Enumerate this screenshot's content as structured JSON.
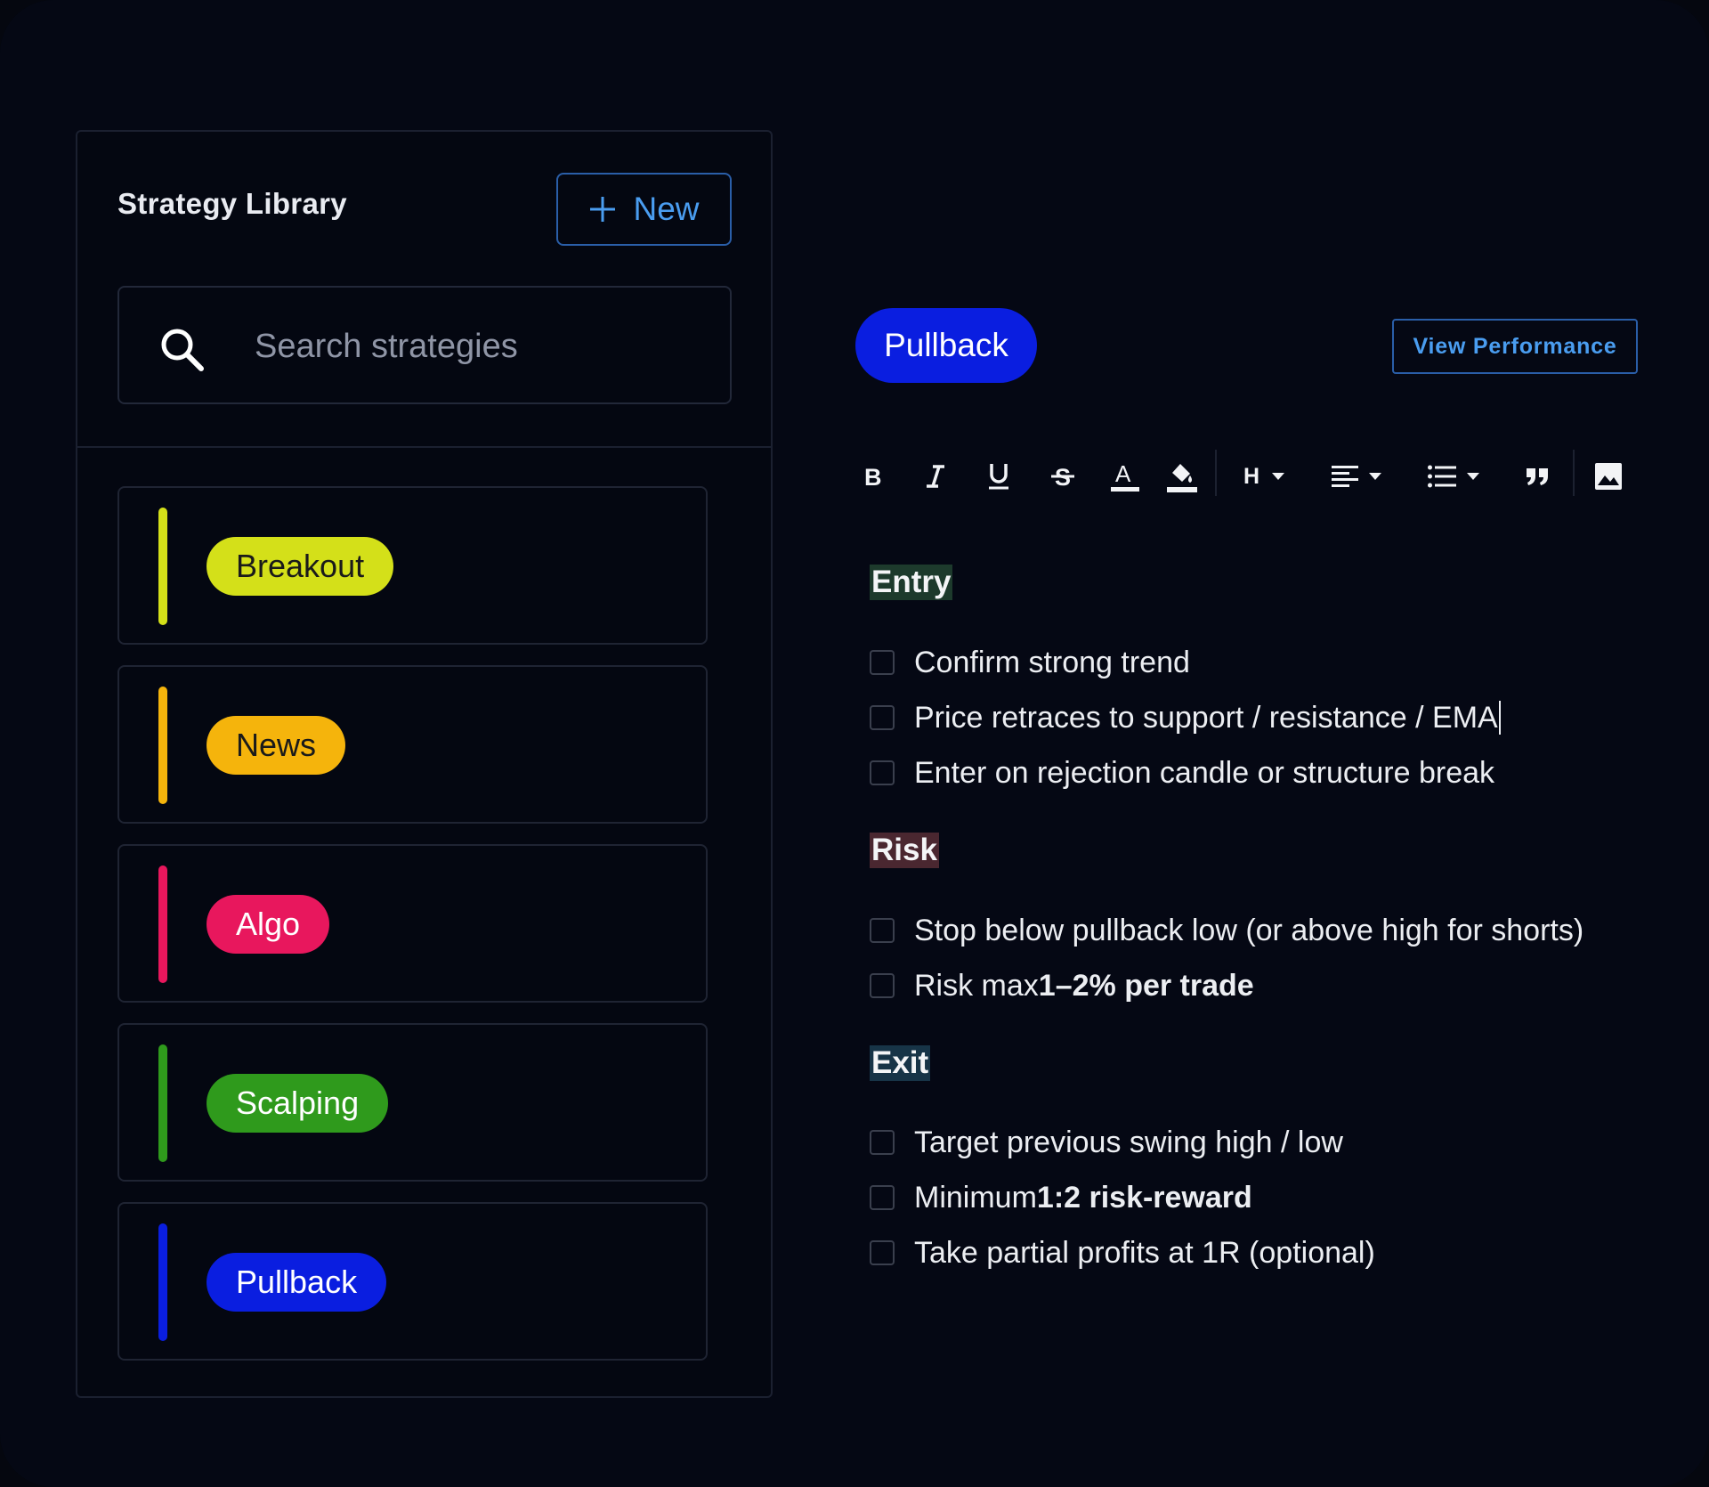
{
  "library": {
    "title": "Strategy Library",
    "new_label": "New",
    "search_placeholder": "Search strategies",
    "strategies": [
      {
        "label": "Breakout",
        "color": "#d4e019",
        "text_color": "#1a1a1a"
      },
      {
        "label": "News",
        "color": "#f5b40c",
        "text_color": "#1a1a1a"
      },
      {
        "label": "Algo",
        "color": "#e8175d",
        "text_color": "#ffffff"
      },
      {
        "label": "Scalping",
        "color": "#2f9a1c",
        "text_color": "#ffffff"
      },
      {
        "label": "Pullback",
        "color": "#0a1ee0",
        "text_color": "#ffffff"
      }
    ]
  },
  "detail": {
    "active_strategy": "Pullback",
    "view_performance_label": "View Performance",
    "toolbar_icons": [
      "bold-icon",
      "italic-icon",
      "underline-icon",
      "strikethrough-icon",
      "text-color-icon",
      "highlight-icon",
      "heading-icon",
      "align-icon",
      "list-icon",
      "quote-icon",
      "image-icon"
    ],
    "heading_letter": "H",
    "sections": {
      "entry": {
        "title": "Entry",
        "items": [
          "Confirm strong trend",
          "Price retraces to support / resistance / EMA",
          "Enter on rejection candle or structure break"
        ]
      },
      "risk": {
        "title": "Risk",
        "item1": "Stop below pullback low (or above high for shorts)",
        "item2_prefix": "Risk max",
        "item2_bold": "1–2% per trade"
      },
      "exit": {
        "title": "Exit",
        "item1": "Target previous swing high / low",
        "item2_prefix": "Minimum",
        "item2_bold": "1:2 risk-reward",
        "item3": "Take partial profits at 1R (optional)"
      }
    }
  }
}
